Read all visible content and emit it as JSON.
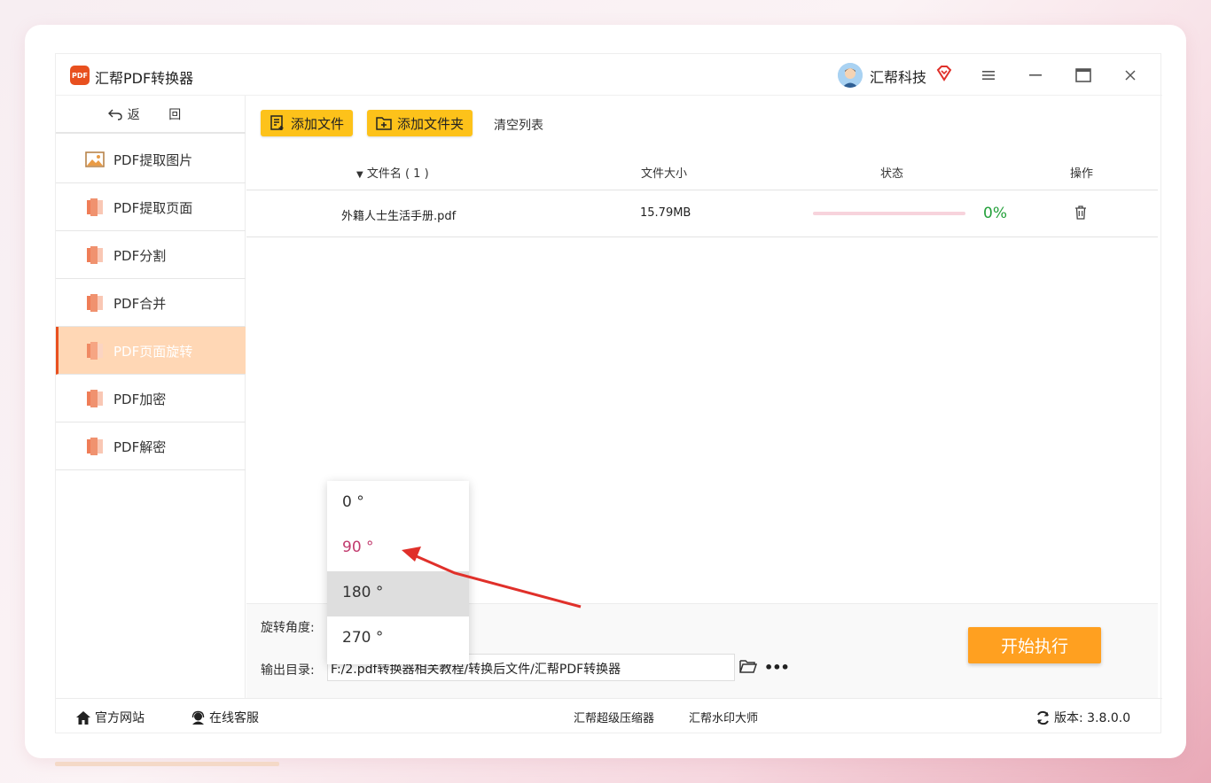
{
  "app": {
    "title": "汇帮PDF转换器",
    "user_name": "汇帮科技"
  },
  "sidebar": {
    "back_label": "返 回",
    "items": [
      {
        "label": "PDF提取图片",
        "icon": "image-icon"
      },
      {
        "label": "PDF提取页面",
        "icon": "pdf-file-icon"
      },
      {
        "label": "PDF分割",
        "icon": "pdf-file-icon"
      },
      {
        "label": "PDF合并",
        "icon": "pdf-file-icon"
      },
      {
        "label": "PDF页面旋转",
        "icon": "pdf-file-icon",
        "active": true
      },
      {
        "label": "PDF加密",
        "icon": "pdf-file-icon"
      },
      {
        "label": "PDF解密",
        "icon": "pdf-file-icon"
      }
    ]
  },
  "toolbar": {
    "add_file": "添加文件",
    "add_folder": "添加文件夹",
    "clear_list": "清空列表"
  },
  "table": {
    "columns": {
      "name": "文件名 ( 1 )",
      "size": "文件大小",
      "status": "状态",
      "action": "操作"
    },
    "rows": [
      {
        "name": "外籍人士生活手册.pdf",
        "size": "15.79MB",
        "progress": 0,
        "progress_label": "0%"
      }
    ]
  },
  "settings": {
    "rotation_label": "旋转角度:",
    "output_label": "输出目录:",
    "output_path": "F:/2.pdf转换器相关教程/转换后文件/汇帮PDF转换器",
    "start_button": "开始执行"
  },
  "dropdown": {
    "options": [
      "0 °",
      "90 °",
      "180 °",
      "270 °"
    ],
    "selected": "90 °",
    "hovered": "180 °"
  },
  "footer": {
    "website": "官方网站",
    "support": "在线客服",
    "link1": "汇帮超级压缩器",
    "link2": "汇帮水印大师",
    "version": "版本:  3.8.0.0"
  },
  "colors": {
    "accent": "#fdc21a",
    "start_button": "#ffa020",
    "active_item": "#ffd7b5",
    "selected_option": "#c23b6e",
    "progress_text": "#23a03a",
    "annotation_arrow": "#e0302a"
  }
}
